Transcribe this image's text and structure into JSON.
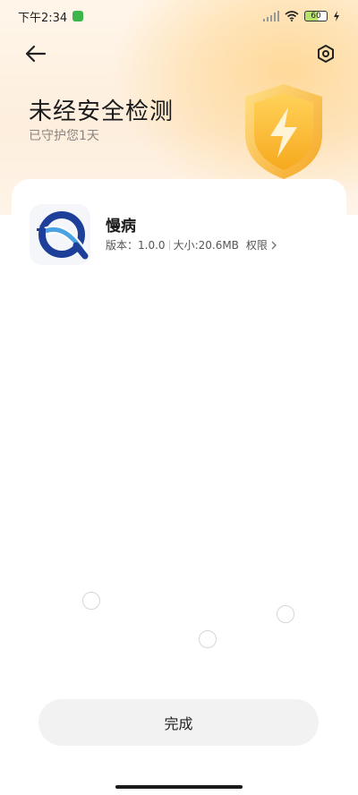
{
  "status_bar": {
    "time": "下午2:34",
    "battery": "60"
  },
  "header": {
    "title": "未经安全检测",
    "subtitle": "已守护您1天"
  },
  "app": {
    "name": "慢病",
    "version_label": "版本：",
    "version": "1.0.0",
    "size_label": "大小:",
    "size": "20.6MB",
    "permissions_label": "权限"
  },
  "footer": {
    "done_label": "完成"
  },
  "colors": {
    "accent": "#f5b62a",
    "hero": "#fdeedd"
  },
  "icons": [
    "back-arrow-icon",
    "settings-icon",
    "shield-lightning-icon",
    "wifi-icon",
    "signal-icon",
    "battery-icon",
    "charging-icon",
    "chevron-right-icon"
  ]
}
